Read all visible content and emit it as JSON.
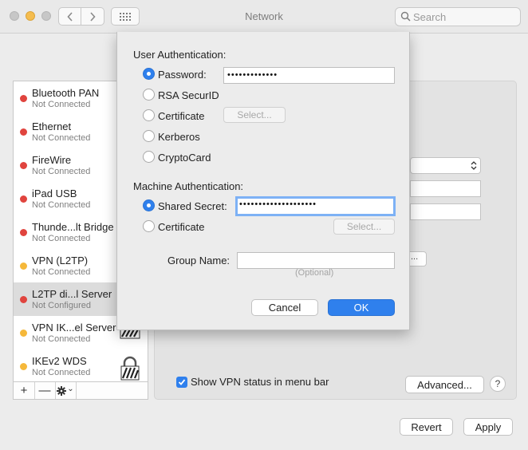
{
  "window": {
    "title": "Network",
    "search_placeholder": "Search"
  },
  "sidebar": {
    "items": [
      {
        "name": "Bluetooth PAN",
        "status": "Not Connected",
        "dot": "#e0443e"
      },
      {
        "name": "Ethernet",
        "status": "Not Connected",
        "dot": "#e0443e"
      },
      {
        "name": "FireWire",
        "status": "Not Connected",
        "dot": "#e0443e"
      },
      {
        "name": "iPad USB",
        "status": "Not Connected",
        "dot": "#e0443e"
      },
      {
        "name": "Thunde...lt Bridge",
        "status": "Not Connected",
        "dot": "#e0443e"
      },
      {
        "name": "VPN (L2TP)",
        "status": "Not Connected",
        "dot": "#f5b83a"
      },
      {
        "name": "L2TP di...l Server",
        "status": "Not Configured",
        "dot": "#e0443e",
        "selected": true
      },
      {
        "name": "VPN IK...el Server",
        "status": "Not Connected",
        "dot": "#f5b83a",
        "icon": "striped-vpn-icon"
      },
      {
        "name": "IKEv2 WDS",
        "status": "Not Connected",
        "dot": "#f5b83a",
        "icon": "lock-icon"
      }
    ],
    "add_label": "+",
    "remove_label": "—",
    "gear_menu_label": "⌄"
  },
  "main": {
    "show_vpn_status_label": "Show VPN status in menu bar",
    "show_vpn_status_checked": true,
    "advanced_label": "Advanced...",
    "help_label": "?",
    "revert_label": "Revert",
    "apply_label": "Apply",
    "hidden_button_label": "..."
  },
  "sheet": {
    "user_auth_heading": "User Authentication:",
    "user_auth_options": [
      {
        "label": "Password:",
        "selected": true
      },
      {
        "label": "RSA SecurID",
        "selected": false
      },
      {
        "label": "Certificate",
        "selected": false
      },
      {
        "label": "Kerberos",
        "selected": false
      },
      {
        "label": "CryptoCard",
        "selected": false
      }
    ],
    "password_value": "•••••••••••••",
    "select_label": "Select...",
    "machine_auth_heading": "Machine Authentication:",
    "machine_auth_options": [
      {
        "label": "Shared Secret:",
        "selected": true
      },
      {
        "label": "Certificate",
        "selected": false
      }
    ],
    "shared_secret_value": "••••••••••••••••••••",
    "group_name_label": "Group Name:",
    "group_name_value": "",
    "optional_note": "(Optional)",
    "cancel_label": "Cancel",
    "ok_label": "OK"
  },
  "colors": {
    "accent": "#2f80ed",
    "red_status": "#e0443e",
    "yellow_status": "#f5b83a"
  }
}
